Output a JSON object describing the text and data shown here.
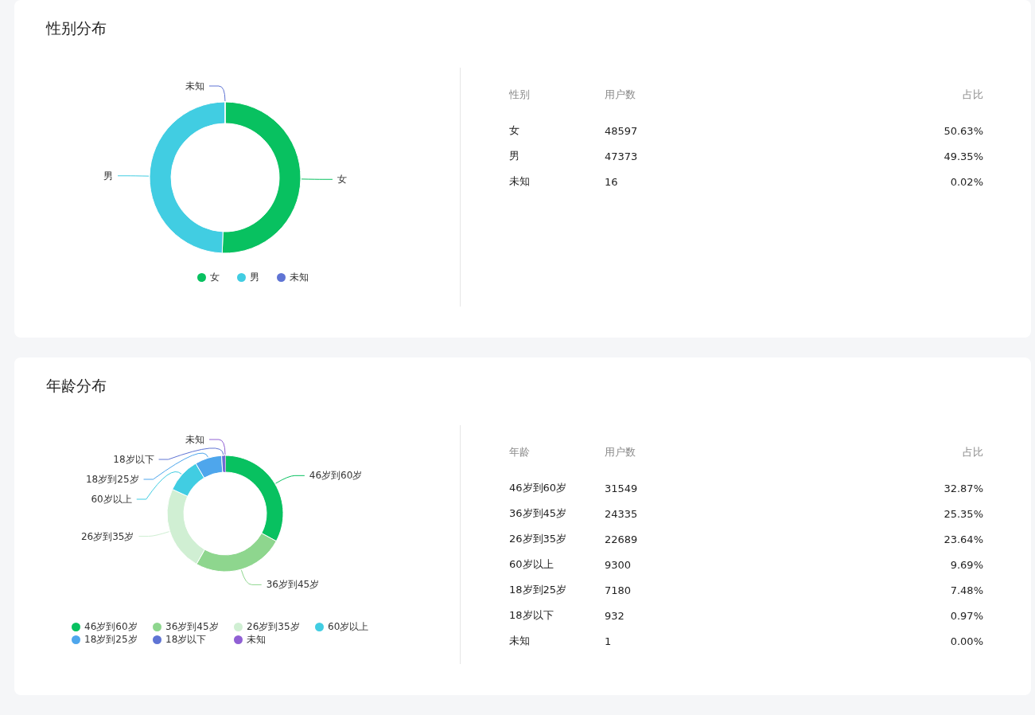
{
  "sections": [
    {
      "title": "性别分布",
      "chart_data": {
        "type": "donut",
        "categories": [
          "女",
          "男",
          "未知"
        ],
        "values": [
          50.63,
          49.35,
          0.02
        ]
      },
      "legend": [
        {
          "label": "女",
          "color": "#08c160"
        },
        {
          "label": "男",
          "color": "#41cde2"
        },
        {
          "label": "未知",
          "color": "#5f74d4"
        }
      ],
      "table": {
        "columns": [
          "性别",
          "用户数",
          "占比"
        ],
        "rows": [
          [
            "女",
            "48597",
            "50.63%"
          ],
          [
            "男",
            "47373",
            "49.35%"
          ],
          [
            "未知",
            "16",
            "0.02%"
          ]
        ]
      }
    },
    {
      "title": "年龄分布",
      "chart_data": {
        "type": "donut",
        "categories": [
          "46岁到60岁",
          "36岁到45岁",
          "26岁到35岁",
          "60岁以上",
          "18岁到25岁",
          "18岁以下",
          "未知"
        ],
        "values": [
          32.87,
          25.35,
          23.64,
          9.69,
          7.48,
          0.97,
          0.0
        ]
      },
      "legend": [
        {
          "label": "46岁到60岁",
          "color": "#08c160"
        },
        {
          "label": "36岁到45岁",
          "color": "#8ed68e"
        },
        {
          "label": "26岁到35岁",
          "color": "#d0efd3"
        },
        {
          "label": "60岁以上",
          "color": "#41cde2"
        },
        {
          "label": "18岁到25岁",
          "color": "#4ea6ec"
        },
        {
          "label": "18岁以下",
          "color": "#5f74d4"
        },
        {
          "label": "未知",
          "color": "#9060d4"
        }
      ],
      "table": {
        "columns": [
          "年龄",
          "用户数",
          "占比"
        ],
        "rows": [
          [
            "46岁到60岁",
            "31549",
            "32.87%"
          ],
          [
            "36岁到45岁",
            "24335",
            "25.35%"
          ],
          [
            "26岁到35岁",
            "22689",
            "23.64%"
          ],
          [
            "60岁以上",
            "9300",
            "9.69%"
          ],
          [
            "18岁到25岁",
            "7180",
            "7.48%"
          ],
          [
            "18岁以下",
            "932",
            "0.97%"
          ],
          [
            "未知",
            "1",
            "0.00%"
          ]
        ]
      }
    }
  ]
}
